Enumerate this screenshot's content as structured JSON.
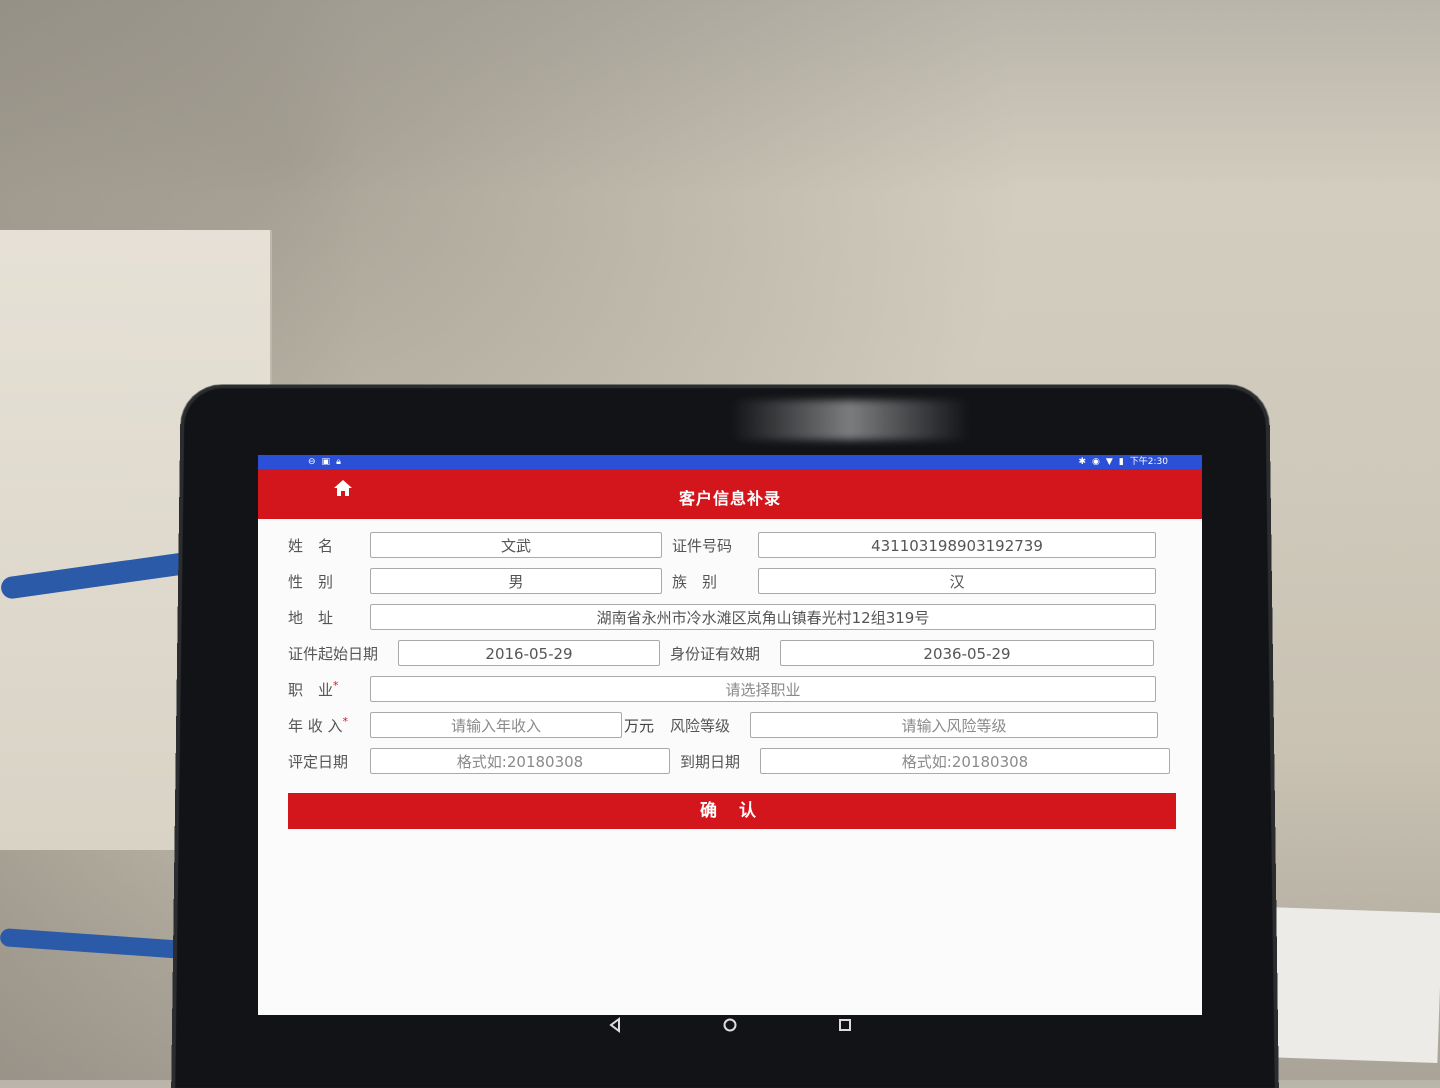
{
  "status_bar": {
    "time": "下午2:30"
  },
  "header": {
    "title": "客户信息补录",
    "home_icon": "home-icon"
  },
  "form": {
    "name": {
      "label": "姓　名",
      "value": "文武"
    },
    "id_number": {
      "label": "证件号码",
      "value": "431103198903192739"
    },
    "gender": {
      "label": "性　别",
      "value": "男"
    },
    "ethnicity": {
      "label": "族　别",
      "value": "汉"
    },
    "address": {
      "label": "地　址",
      "value": "湖南省永州市冷水滩区岚角山镇春光村12组319号"
    },
    "id_start_date": {
      "label": "证件起始日期",
      "value": "2016-05-29"
    },
    "id_valid_date": {
      "label": "身份证有效期",
      "value": "2036-05-29"
    },
    "occupation": {
      "label": "职　业",
      "placeholder": "请选择职业"
    },
    "annual_income": {
      "label": "年 收 入",
      "placeholder": "请输入年收入",
      "unit": "万元"
    },
    "risk_level": {
      "label": "风险等级",
      "placeholder": "请输入风险等级"
    },
    "rating_date": {
      "label": "评定日期",
      "placeholder": "格式如:20180308"
    },
    "expiry_date": {
      "label": "到期日期",
      "placeholder": "格式如:20180308"
    },
    "required_mark": "*"
  },
  "actions": {
    "confirm_label": "确 认"
  },
  "colors": {
    "brand_red": "#d3161c",
    "status_blue": "#2b4fd6"
  }
}
